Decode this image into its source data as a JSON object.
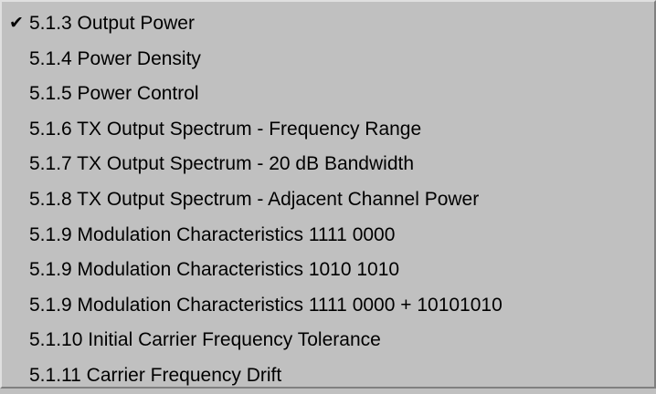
{
  "menu": {
    "items": [
      {
        "label": "5.1.3  Output Power",
        "checked": true
      },
      {
        "label": "5.1.4  Power Density",
        "checked": false
      },
      {
        "label": "5.1.5  Power Control",
        "checked": false
      },
      {
        "label": "5.1.6  TX Output Spectrum - Frequency Range",
        "checked": false
      },
      {
        "label": "5.1.7  TX Output Spectrum - 20 dB Bandwidth",
        "checked": false
      },
      {
        "label": "5.1.8  TX Output Spectrum - Adjacent Channel Power",
        "checked": false
      },
      {
        "label": "5.1.9  Modulation Characteristics  1111 0000",
        "checked": false
      },
      {
        "label": "5.1.9  Modulation Characteristics  1010 1010",
        "checked": false
      },
      {
        "label": "5.1.9  Modulation Characteristics  1111 0000 + 10101010",
        "checked": false
      },
      {
        "label": "5.1.10  Initial Carrier Frequency Tolerance",
        "checked": false
      },
      {
        "label": "5.1.11  Carrier Frequency Drift",
        "checked": false
      }
    ],
    "check_glyph": "✔",
    "check_icon": "checkmark-icon"
  }
}
